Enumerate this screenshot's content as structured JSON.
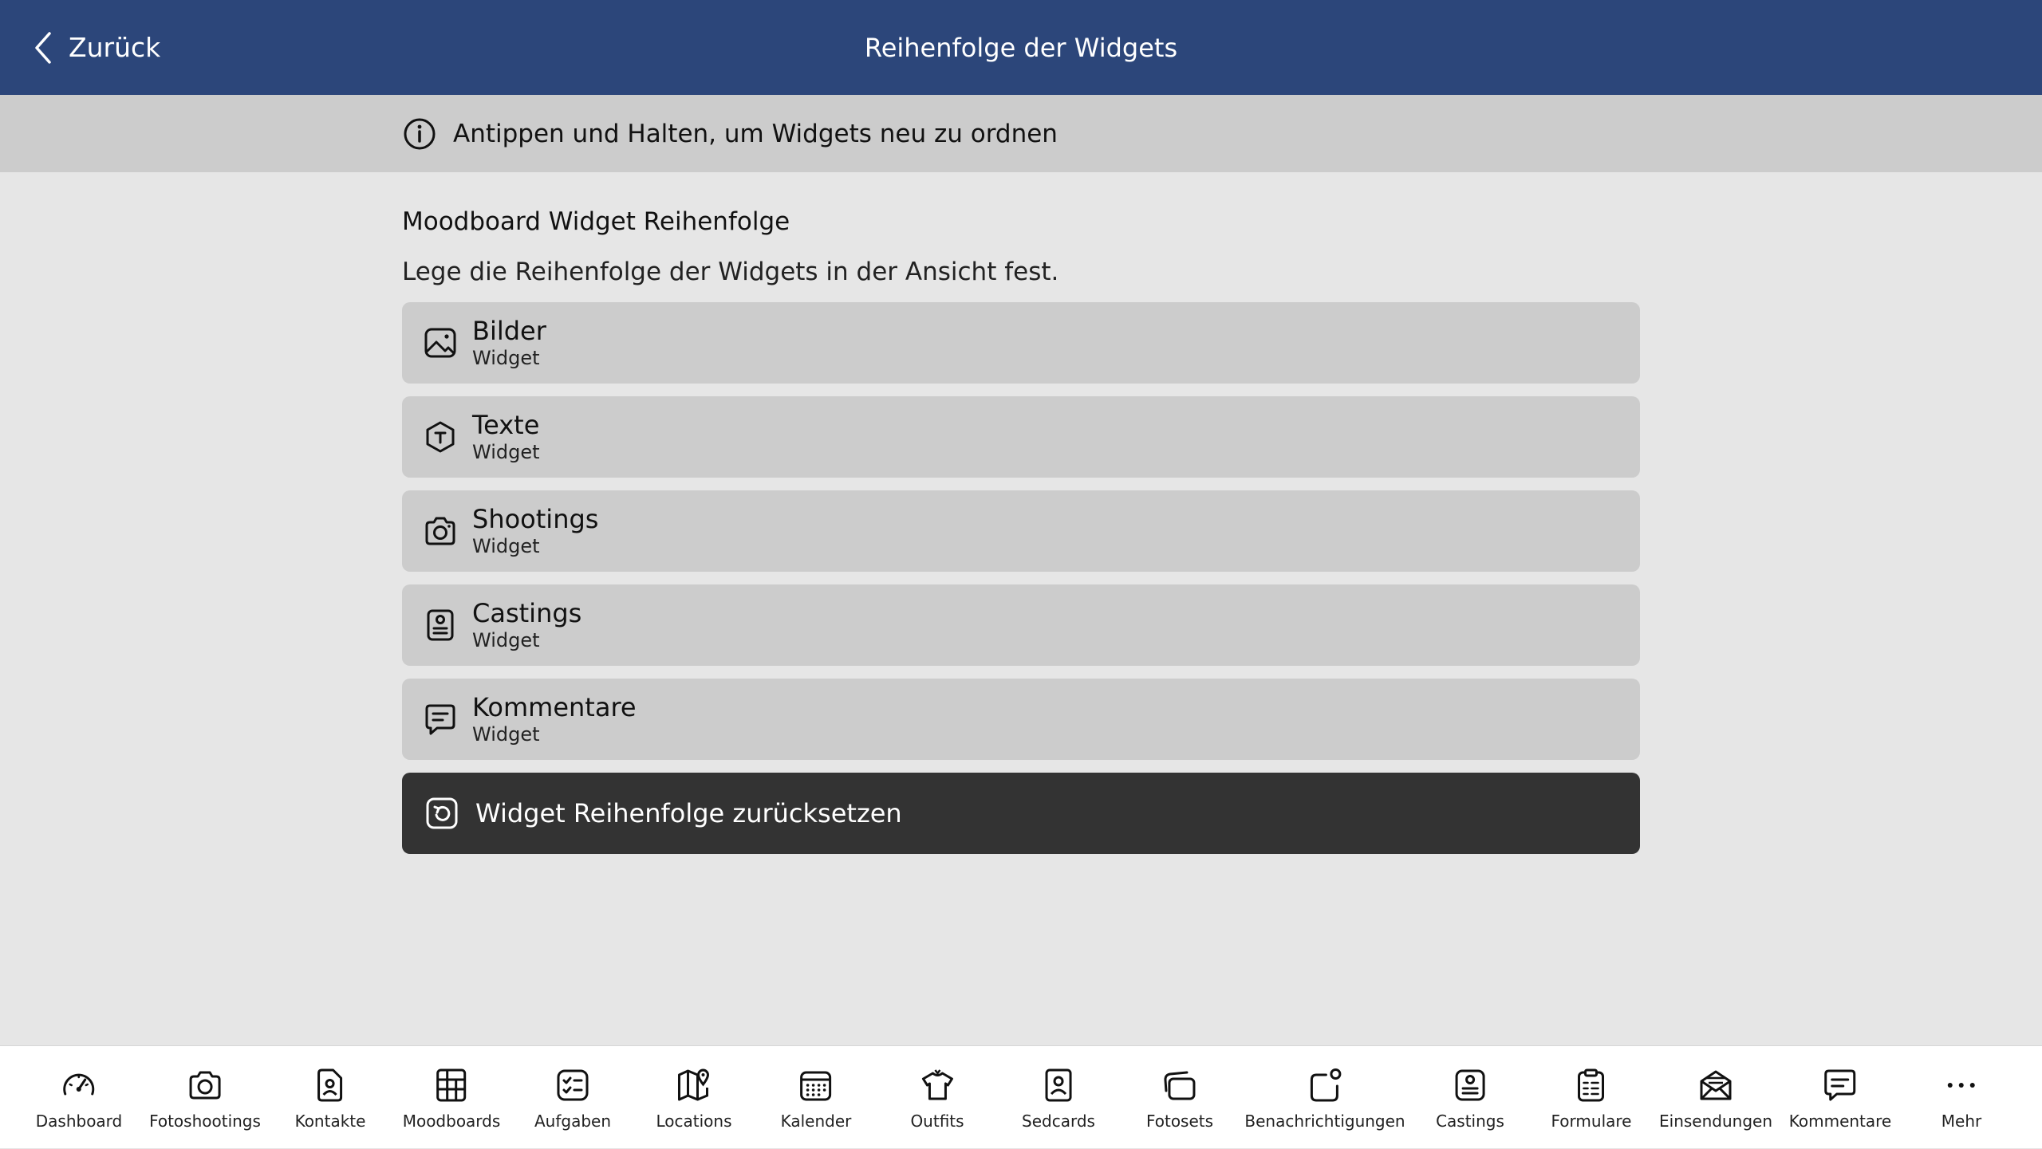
{
  "header": {
    "back_label": "Zurück",
    "title": "Reihenfolge der Widgets"
  },
  "hint": {
    "text": "Antippen und Halten, um Widgets neu zu ordnen"
  },
  "section": {
    "title": "Moodboard Widget Reihenfolge",
    "description": "Lege die Reihenfolge der Widgets in der Ansicht fest."
  },
  "widgets": [
    {
      "label": "Bilder",
      "sub": "Widget",
      "icon": "image-icon"
    },
    {
      "label": "Texte",
      "sub": "Widget",
      "icon": "text-icon"
    },
    {
      "label": "Shootings",
      "sub": "Widget",
      "icon": "camera-icon"
    },
    {
      "label": "Castings",
      "sub": "Widget",
      "icon": "casting-icon"
    },
    {
      "label": "Kommentare",
      "sub": "Widget",
      "icon": "comment-icon"
    }
  ],
  "reset": {
    "label": "Widget Reihenfolge zurücksetzen",
    "icon": "reset-icon"
  },
  "tabs": [
    {
      "label": "Dashboard",
      "icon": "dashboard-icon"
    },
    {
      "label": "Fotoshootings",
      "icon": "camera-icon"
    },
    {
      "label": "Kontakte",
      "icon": "contact-icon"
    },
    {
      "label": "Moodboards",
      "icon": "moodboard-icon"
    },
    {
      "label": "Aufgaben",
      "icon": "tasks-icon"
    },
    {
      "label": "Locations",
      "icon": "map-icon"
    },
    {
      "label": "Kalender",
      "icon": "calendar-icon"
    },
    {
      "label": "Outfits",
      "icon": "shirt-icon"
    },
    {
      "label": "Sedcards",
      "icon": "sedcard-icon"
    },
    {
      "label": "Fotosets",
      "icon": "photoset-icon"
    },
    {
      "label": "Benachrichtigungen",
      "icon": "notification-icon"
    },
    {
      "label": "Castings",
      "icon": "casting-icon"
    },
    {
      "label": "Formulare",
      "icon": "form-icon"
    },
    {
      "label": "Einsendungen",
      "icon": "mail-icon"
    },
    {
      "label": "Kommentare",
      "icon": "comment-icon"
    },
    {
      "label": "Mehr",
      "icon": "more-icon"
    }
  ],
  "colors": {
    "header": "#2c467a",
    "hint_bar": "#cccccc",
    "background": "#e6e6e6",
    "reset_button": "#333333"
  }
}
